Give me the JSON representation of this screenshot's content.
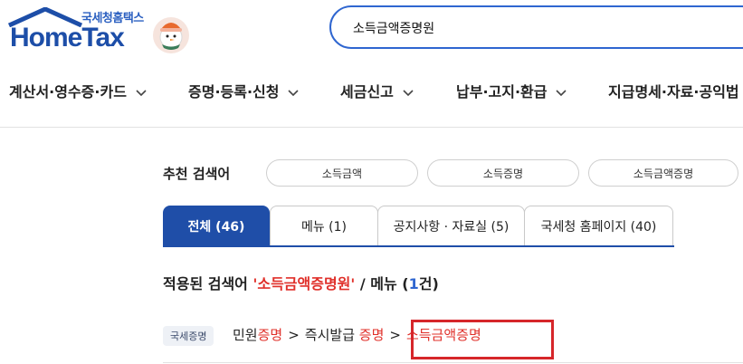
{
  "header": {
    "logo_sub": "국세청홈택스",
    "logo_main": "HomeTax",
    "search_value": "소득금액증명원"
  },
  "nav": {
    "items": [
      {
        "label": "계산서·영수증·카드"
      },
      {
        "label": "증명·등록·신청"
      },
      {
        "label": "세금신고"
      },
      {
        "label": "납부·고지·환급"
      },
      {
        "label": "지급명세·자료·공익법"
      }
    ]
  },
  "recommended": {
    "label": "추천 검색어",
    "keywords": [
      "소득금액",
      "소득증명",
      "소득금액증명"
    ]
  },
  "tabs": [
    {
      "label": "전체 (46)",
      "active": true
    },
    {
      "label": "메뉴 (1)",
      "active": false
    },
    {
      "label": "공지사항 · 자료실 (5)",
      "active": false
    },
    {
      "label": "국세청 홈페이지 (40)",
      "active": false
    }
  ],
  "result": {
    "prefix": "적용된 검색어 ",
    "query": "'소득금액증명원'",
    "middle": " / 메뉴 (",
    "count": "1",
    "suffix": "건)"
  },
  "breadcrumb": {
    "badge": "국세증명",
    "part1_a": "민원",
    "part1_b": "증명",
    "sep": ">",
    "part2_a": "즉시발급 ",
    "part2_b": "증명",
    "part3": "소득금액증명"
  },
  "colors": {
    "brand_blue": "#1f4ea8",
    "search_border": "#2f66d0",
    "highlight_red": "#e0302a",
    "box_red": "#d6262a"
  }
}
